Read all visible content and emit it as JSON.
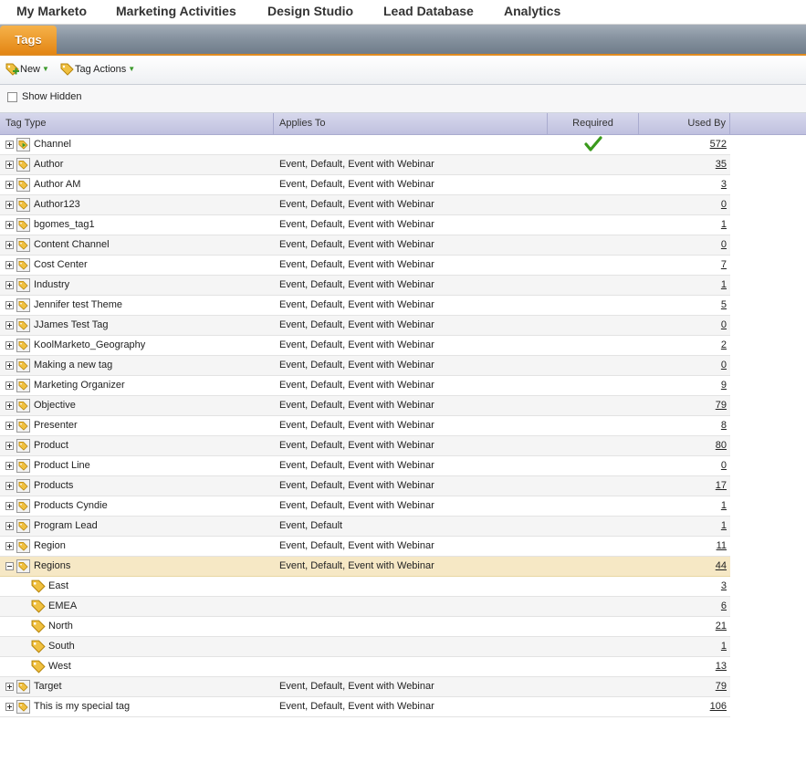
{
  "nav": {
    "items": [
      "My Marketo",
      "Marketing Activities",
      "Design Studio",
      "Lead Database",
      "Analytics"
    ]
  },
  "tabs": {
    "active": "Tags"
  },
  "toolbar": {
    "new_label": "New",
    "tag_actions_label": "Tag Actions"
  },
  "filter": {
    "show_hidden_label": "Show Hidden",
    "show_hidden_checked": false
  },
  "grid": {
    "columns": {
      "tag_type": "Tag Type",
      "applies_to": "Applies To",
      "required": "Required",
      "used_by": "Used By"
    },
    "rows": [
      {
        "name": "Channel",
        "applies_to": "",
        "required": true,
        "used_by": "572",
        "level": 0,
        "expanded": false,
        "kind": "channel"
      },
      {
        "name": "Author",
        "applies_to": "Event, Default, Event with Webinar",
        "used_by": "35",
        "level": 0,
        "expanded": false
      },
      {
        "name": "Author AM",
        "applies_to": "Event, Default, Event with Webinar",
        "used_by": "3",
        "level": 0,
        "expanded": false
      },
      {
        "name": "Author123",
        "applies_to": "Event, Default, Event with Webinar",
        "used_by": "0",
        "level": 0,
        "expanded": false
      },
      {
        "name": "bgomes_tag1",
        "applies_to": "Event, Default, Event with Webinar",
        "used_by": "1",
        "level": 0,
        "expanded": false
      },
      {
        "name": "Content Channel",
        "applies_to": "Event, Default, Event with Webinar",
        "used_by": "0",
        "level": 0,
        "expanded": false
      },
      {
        "name": "Cost Center",
        "applies_to": "Event, Default, Event with Webinar",
        "used_by": "7",
        "level": 0,
        "expanded": false
      },
      {
        "name": "Industry",
        "applies_to": "Event, Default, Event with Webinar",
        "used_by": "1",
        "level": 0,
        "expanded": false
      },
      {
        "name": "Jennifer test Theme",
        "applies_to": "Event, Default, Event with Webinar",
        "used_by": "5",
        "level": 0,
        "expanded": false
      },
      {
        "name": "JJames Test Tag",
        "applies_to": "Event, Default, Event with Webinar",
        "used_by": "0",
        "level": 0,
        "expanded": false
      },
      {
        "name": "KoolMarketo_Geography",
        "applies_to": "Event, Default, Event with Webinar",
        "used_by": "2",
        "level": 0,
        "expanded": false
      },
      {
        "name": "Making a new tag",
        "applies_to": "Event, Default, Event with Webinar",
        "used_by": "0",
        "level": 0,
        "expanded": false
      },
      {
        "name": "Marketing Organizer",
        "applies_to": "Event, Default, Event with Webinar",
        "used_by": "9",
        "level": 0,
        "expanded": false
      },
      {
        "name": "Objective",
        "applies_to": "Event, Default, Event with Webinar",
        "used_by": "79",
        "level": 0,
        "expanded": false
      },
      {
        "name": "Presenter",
        "applies_to": "Event, Default, Event with Webinar",
        "used_by": "8",
        "level": 0,
        "expanded": false
      },
      {
        "name": "Product",
        "applies_to": "Event, Default, Event with Webinar",
        "used_by": "80",
        "level": 0,
        "expanded": false
      },
      {
        "name": "Product Line",
        "applies_to": "Event, Default, Event with Webinar",
        "used_by": "0",
        "level": 0,
        "expanded": false
      },
      {
        "name": "Products",
        "applies_to": "Event, Default, Event with Webinar",
        "used_by": "17",
        "level": 0,
        "expanded": false
      },
      {
        "name": "Products Cyndie",
        "applies_to": "Event, Default, Event with Webinar",
        "used_by": "1",
        "level": 0,
        "expanded": false
      },
      {
        "name": "Program Lead",
        "applies_to": "Event, Default",
        "used_by": "1",
        "level": 0,
        "expanded": false
      },
      {
        "name": "Region",
        "applies_to": "Event, Default, Event with Webinar",
        "used_by": "11",
        "level": 0,
        "expanded": false
      },
      {
        "name": "Regions",
        "applies_to": "Event, Default, Event with Webinar",
        "used_by": "44",
        "level": 0,
        "expanded": true,
        "selected": true
      },
      {
        "name": "East",
        "applies_to": "",
        "used_by": "3",
        "level": 1
      },
      {
        "name": "EMEA",
        "applies_to": "",
        "used_by": "6",
        "level": 1
      },
      {
        "name": "North",
        "applies_to": "",
        "used_by": "21",
        "level": 1
      },
      {
        "name": "South",
        "applies_to": "",
        "used_by": "1",
        "level": 1
      },
      {
        "name": "West",
        "applies_to": "",
        "used_by": "13",
        "level": 1
      },
      {
        "name": "Target",
        "applies_to": "Event, Default, Event with Webinar",
        "used_by": "79",
        "level": 0,
        "expanded": false
      },
      {
        "name": "This is my special tag",
        "applies_to": "Event, Default, Event with Webinar",
        "used_by": "106",
        "level": 0,
        "expanded": false
      }
    ]
  },
  "colors": {
    "accent": "#e38614",
    "header": "#c7c8e4",
    "selected_row": "#f6e8c5",
    "check": "#3a9a1c"
  }
}
